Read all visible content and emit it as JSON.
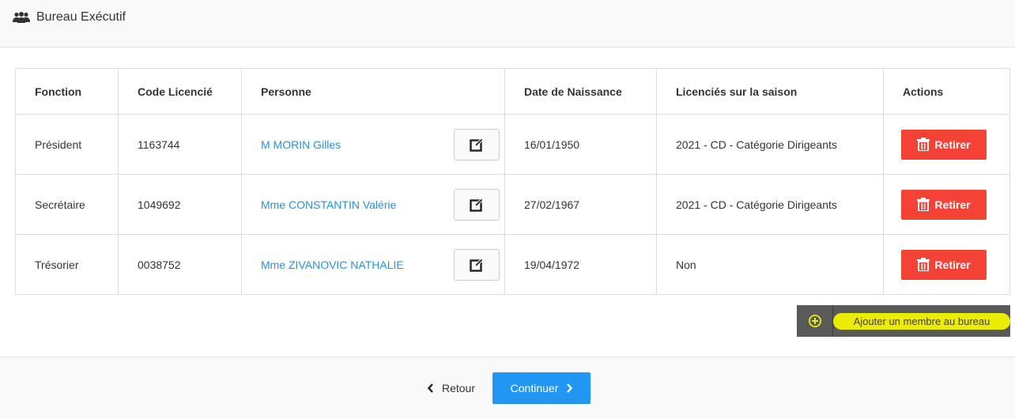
{
  "header": {
    "title": "Bureau Exécutif",
    "icon": "users-icon"
  },
  "table": {
    "headers": [
      "Fonction",
      "Code Licencié",
      "Personne",
      "Date de Naissance",
      "Licenciés sur la saison",
      "Actions"
    ],
    "rows": [
      {
        "fonction": "Président",
        "code": "1163744",
        "personne": "M MORIN Gilles",
        "date": "16/01/1950",
        "saison": "2021 - CD - Catégorie Dirigeants",
        "action": "Retirer"
      },
      {
        "fonction": "Secrétaire",
        "code": "1049692",
        "personne": "Mme CONSTANTIN Valérie",
        "date": "27/02/1967",
        "saison": "2021 - CD - Catégorie Dirigeants",
        "action": "Retirer"
      },
      {
        "fonction": "Trésorier",
        "code": "0038752",
        "personne": "Mme ZIVANOVIC NATHALIE",
        "date": "19/04/1972",
        "saison": "Non",
        "action": "Retirer"
      }
    ]
  },
  "add_member": {
    "label": "Ajouter un membre au bureau",
    "icon": "plus-circle-icon"
  },
  "footer": {
    "retour": "Retour",
    "continuer": "Continuer"
  },
  "colors": {
    "link": "#2b8fe0",
    "danger": "#f44336",
    "primary": "#2196f3",
    "highlight": "#ecec00"
  }
}
